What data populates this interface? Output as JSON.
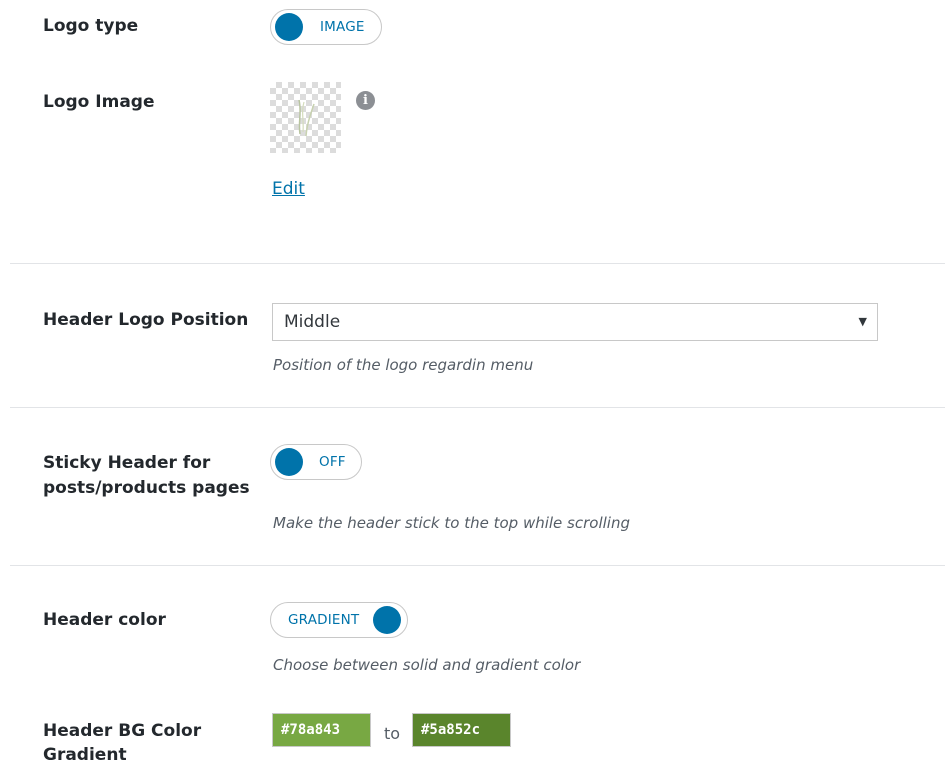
{
  "logo_type": {
    "label": "Logo type",
    "toggle_text": "IMAGE"
  },
  "logo_image": {
    "label": "Logo Image",
    "info_glyph": "i",
    "edit_link": "Edit"
  },
  "header_logo_position": {
    "label": "Header Logo Position",
    "selected": "Middle",
    "help": "Position of the logo regardin menu"
  },
  "sticky_header": {
    "label_line1": "Sticky Header for",
    "label_line2": "posts/products pages",
    "toggle_text": "OFF",
    "help": "Make the header stick to the top while scrolling"
  },
  "header_color": {
    "label": "Header color",
    "toggle_text": "GRADIENT",
    "help": "Choose between solid and gradient color"
  },
  "header_bg_gradient": {
    "label_line1": "Header BG Color",
    "label_line2": "Gradient",
    "color_from": "#78a843",
    "to_word": "to",
    "color_to": "#5a852c"
  },
  "colors": {
    "accent": "#0073aa",
    "gradient_from": "#78a843",
    "gradient_to": "#5a852c"
  },
  "icons": {
    "info": "info-icon",
    "dropdown": "triangle-down-icon"
  }
}
